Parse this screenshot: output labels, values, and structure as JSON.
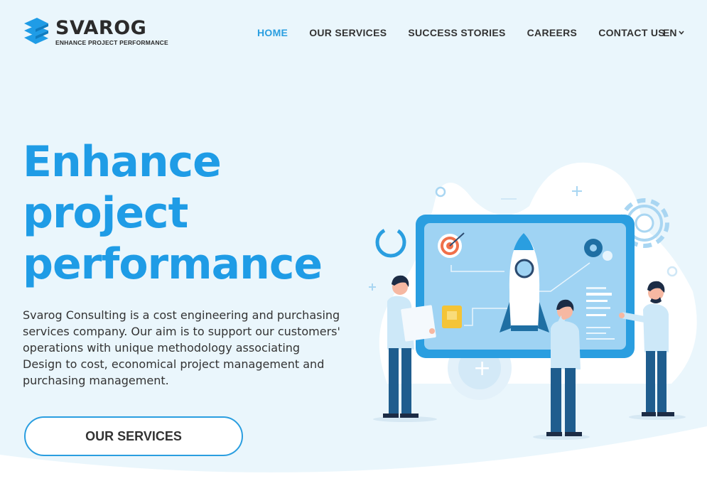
{
  "brand": {
    "name": "SVAROG",
    "tagline": "ENHANCE PROJECT PERFORMANCE",
    "logo_icon": "svarog-stripes-icon",
    "accent_color": "#2a9ee0"
  },
  "nav": {
    "items": [
      {
        "label": "HOME",
        "active": true
      },
      {
        "label": "OUR SERVICES",
        "active": false
      },
      {
        "label": "SUCCESS STORIES",
        "active": false
      },
      {
        "label": "CAREERS",
        "active": false
      },
      {
        "label": "CONTACT US",
        "active": false
      }
    ],
    "language": "EN",
    "language_icon": "chevron-down-icon"
  },
  "hero": {
    "title_lines": [
      "Enhance",
      "project",
      "performance"
    ],
    "description": "Svarog Consulting is a cost engineering and purchasing services company. Our aim is to support our customers' operations with unique methodology associating Design to cost, economical project management and purchasing management.",
    "cta_label": "OUR SERVICES",
    "title_color": "#1f9ce6"
  }
}
